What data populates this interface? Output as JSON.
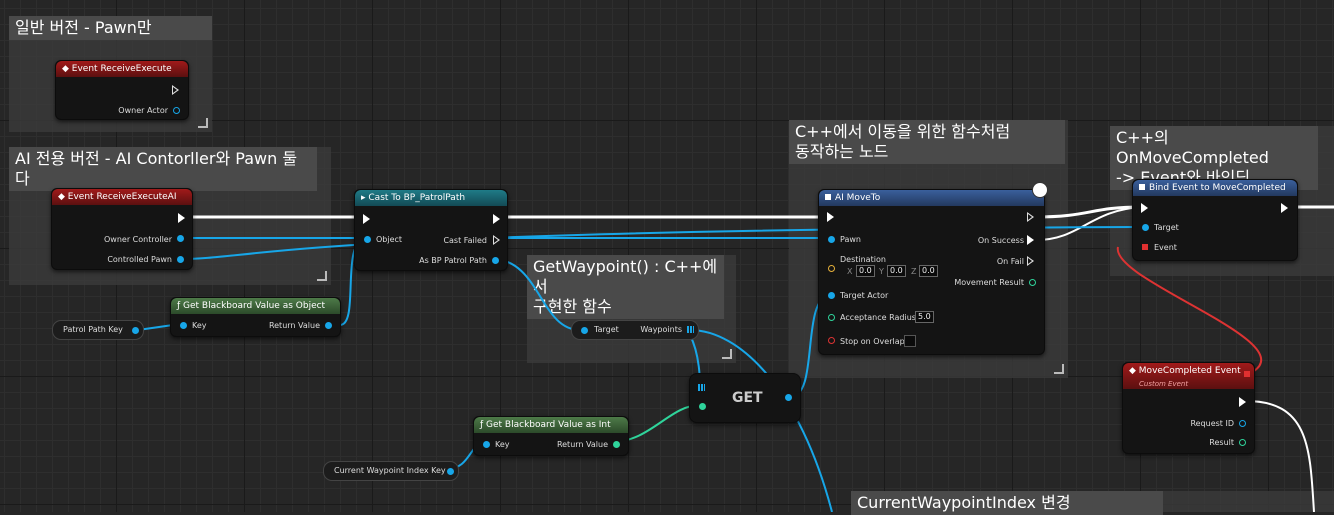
{
  "comments": {
    "general": "일반 버전 - Pawn만",
    "ai_only": "AI 전용 버전 - AI Contorller와 Pawn 둘다",
    "getwaypoint": "GetWaypoint() : C++에서\n구현한 함수",
    "moveto": "C++에서 이동을 위한 함수처럼\n동작하는 노드",
    "onmove": "C++의 OnMoveCompleted\n-> Event와 바인딩",
    "current": "CurrentWaypointIndex 변경"
  },
  "nodes": {
    "event_execute": {
      "title": "Event ReceiveExecute",
      "owner_actor": "Owner Actor"
    },
    "event_execute_ai": {
      "title": "Event ReceiveExecuteAI",
      "owner_controller": "Owner Controller",
      "controlled_pawn": "Controlled Pawn"
    },
    "cast": {
      "title": "Cast To BP_PatrolPath",
      "object": "Object",
      "cast_failed": "Cast Failed",
      "as_path": "As BP Patrol Path"
    },
    "get_bb_object": {
      "title": "Get Blackboard Value as Object",
      "key": "Key",
      "return_value": "Return Value"
    },
    "patrol_key": {
      "label": "Patrol Path Key"
    },
    "getwaypoint_fn": {
      "target": "Target",
      "waypoints": "Waypoints"
    },
    "get": {
      "label": "GET"
    },
    "get_bb_int": {
      "title": "Get Blackboard Value as Int",
      "key": "Key",
      "return_value": "Return Value"
    },
    "current_key": {
      "label": "Current Waypoint Index Key"
    },
    "ai_moveto": {
      "title": "AI MoveTo",
      "pawn": "Pawn",
      "destination": "Destination",
      "x_label": "X",
      "x": "0.0",
      "y_label": "Y",
      "y": "0.0",
      "z_label": "Z",
      "z": "0.0",
      "target_actor": "Target Actor",
      "acceptance_radius": "Acceptance Radius",
      "radius_value": "5.0",
      "stop_on_overlap": "Stop on Overlap",
      "on_success": "On Success",
      "on_fail": "On Fail",
      "movement_result": "Movement Result"
    },
    "bind_event": {
      "title": "Bind Event to MoveCompleted",
      "target": "Target",
      "event": "Event"
    },
    "move_completed": {
      "title": "MoveCompleted Event",
      "subtitle": "Custom Event",
      "request_id": "Request ID",
      "result": "Result"
    }
  },
  "colors": {
    "exec": "#ffffff",
    "object": "#17a6e8",
    "int": "#2fd49b",
    "delegate": "#e03030",
    "vector": "#e5b03a"
  }
}
